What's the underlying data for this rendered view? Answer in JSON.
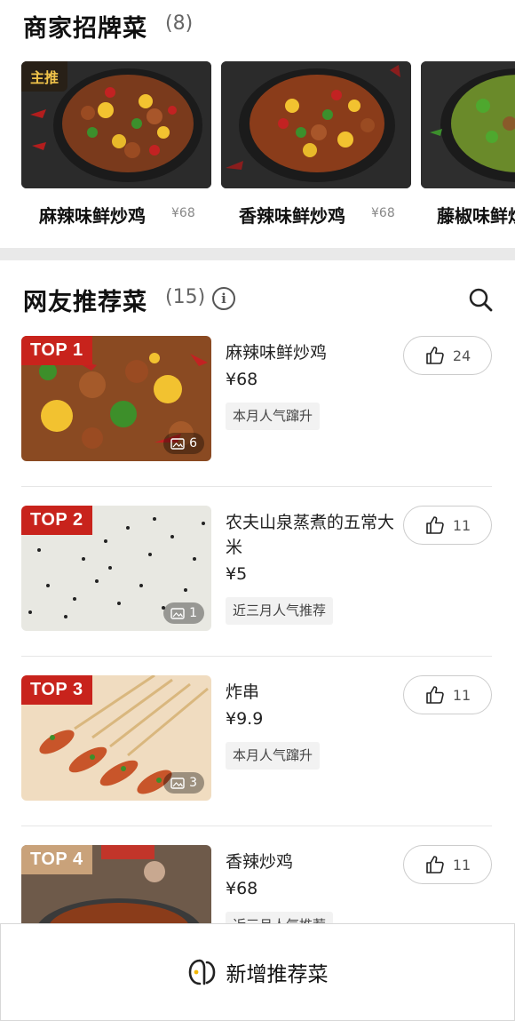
{
  "signature": {
    "title": "商家招牌菜",
    "count": "(8)",
    "badge": "主推",
    "dishes": [
      {
        "name": "麻辣味鲜炒鸡",
        "price": "¥68"
      },
      {
        "name": "香辣味鲜炒鸡",
        "price": "¥68"
      },
      {
        "name": "藤椒味鲜炒鸡",
        "price": ""
      }
    ]
  },
  "recommended": {
    "title": "网友推荐菜",
    "count": "(15)",
    "info_glyph": "i",
    "items": [
      {
        "rank": "TOP 1",
        "name": "麻辣味鲜炒鸡",
        "price": "¥68",
        "tag": "本月人气蹿升",
        "likes": "24",
        "photos": "6"
      },
      {
        "rank": "TOP 2",
        "name": "农夫山泉蒸煮的五常大米",
        "price": "¥5",
        "tag": "近三月人气推荐",
        "likes": "11",
        "photos": "1"
      },
      {
        "rank": "TOP 3",
        "name": "炸串",
        "price": "¥9.9",
        "tag": "本月人气蹿升",
        "likes": "11",
        "photos": "3"
      },
      {
        "rank": "TOP 4",
        "name": "香辣炒鸡",
        "price": "¥68",
        "tag": "近三月人气推荐",
        "likes": "11",
        "photos": ""
      }
    ]
  },
  "bottom_bar": {
    "label": "新增推荐菜",
    "icon": "add-dish-icon"
  },
  "colors": {
    "top_red": "#c8231c",
    "top4_tan": "#c9a27a",
    "badge_gold": "#f0c34a"
  }
}
